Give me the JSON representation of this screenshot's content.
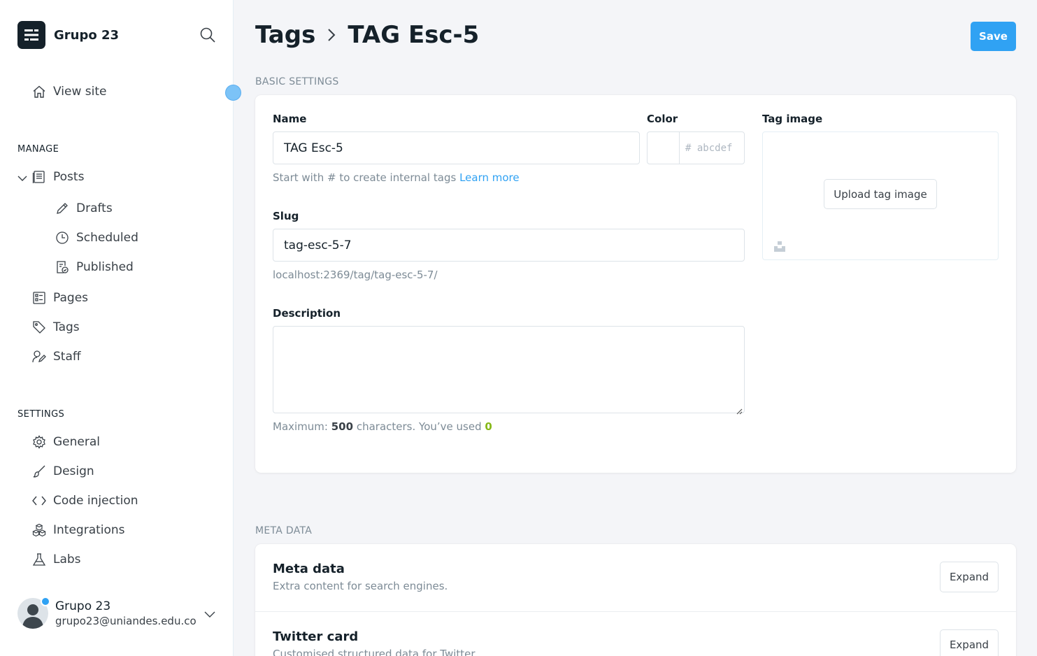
{
  "sidebar": {
    "brand_name": "Grupo 23",
    "view_site": "View site",
    "manage_label": "MANAGE",
    "settings_label": "SETTINGS",
    "posts": "Posts",
    "drafts": "Drafts",
    "scheduled": "Scheduled",
    "published": "Published",
    "pages": "Pages",
    "tags": "Tags",
    "staff": "Staff",
    "general": "General",
    "design": "Design",
    "code_injection": "Code injection",
    "integrations": "Integrations",
    "labs": "Labs",
    "user_name": "Grupo 23",
    "user_email": "grupo23@uniandes.edu.co"
  },
  "header": {
    "parent": "Tags",
    "current": "TAG Esc-5",
    "save_label": "Save"
  },
  "basic": {
    "section_label": "BASIC SETTINGS",
    "name_label": "Name",
    "name_value": "TAG Esc-5",
    "color_label": "Color",
    "color_placeholder": "# abcdef",
    "name_help": "Start with # to create internal tags",
    "learn_more": "Learn more",
    "tag_image_label": "Tag image",
    "upload_label": "Upload tag image",
    "slug_label": "Slug",
    "slug_value": "tag-esc-5-7",
    "slug_url": "localhost:2369/tag/tag-esc-5-7/",
    "description_label": "Description",
    "desc_help_prefix": "Maximum:",
    "desc_max": "500",
    "desc_help_mid": "characters. You’ve used",
    "desc_used": "0"
  },
  "meta": {
    "section_label": "META DATA",
    "rows": [
      {
        "title": "Meta data",
        "desc": "Extra content for search engines.",
        "button": "Expand"
      },
      {
        "title": "Twitter card",
        "desc": "Customised structured data for Twitter",
        "button": "Expand"
      }
    ]
  },
  "colors": {
    "accent": "#30a2f3",
    "dark": "#15212a",
    "green": "#86b818"
  }
}
